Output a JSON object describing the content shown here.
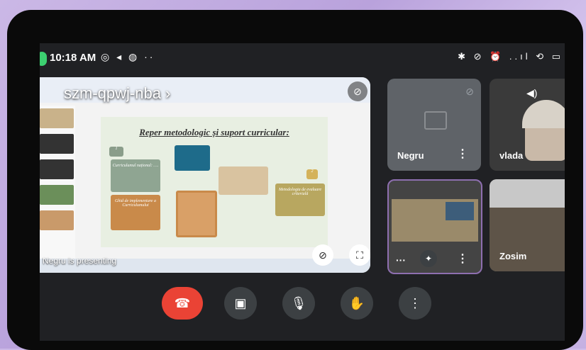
{
  "status_bar": {
    "time": "10:18 AM",
    "left_icons": "◎ ◂ ◍ ··",
    "right_icons": "✱ ⊘ ⏰ ..ıl ⟲ ▭"
  },
  "meeting": {
    "code": "szm-qpwj-nba",
    "chevron": "›",
    "presenter_label": "Negru is presenting"
  },
  "slide": {
    "title": "Reper metodologic și suport curricular:",
    "boxes": [
      "Curriculumul național: ….",
      "Ghid de implementare a Curriculumului",
      "Metodologia de evaluare criterială",
      "1",
      "2"
    ]
  },
  "participants": [
    {
      "name": "Negru",
      "muted": true
    },
    {
      "name": "vlada",
      "speaking": true
    },
    {
      "name": "",
      "self": true
    },
    {
      "name": "Zosim"
    }
  ],
  "controls": [
    {
      "name": "end-call",
      "glyph": "☎"
    },
    {
      "name": "camera",
      "glyph": "▣"
    },
    {
      "name": "microphone",
      "glyph": "🎙"
    },
    {
      "name": "raise-hand",
      "glyph": "✋"
    },
    {
      "name": "more",
      "glyph": "⋮"
    }
  ],
  "icons": {
    "mute": "mic-off-icon",
    "fullscreen": "fullscreen-icon",
    "effects": "sparkle-icon",
    "audio": "speaker-icon"
  }
}
